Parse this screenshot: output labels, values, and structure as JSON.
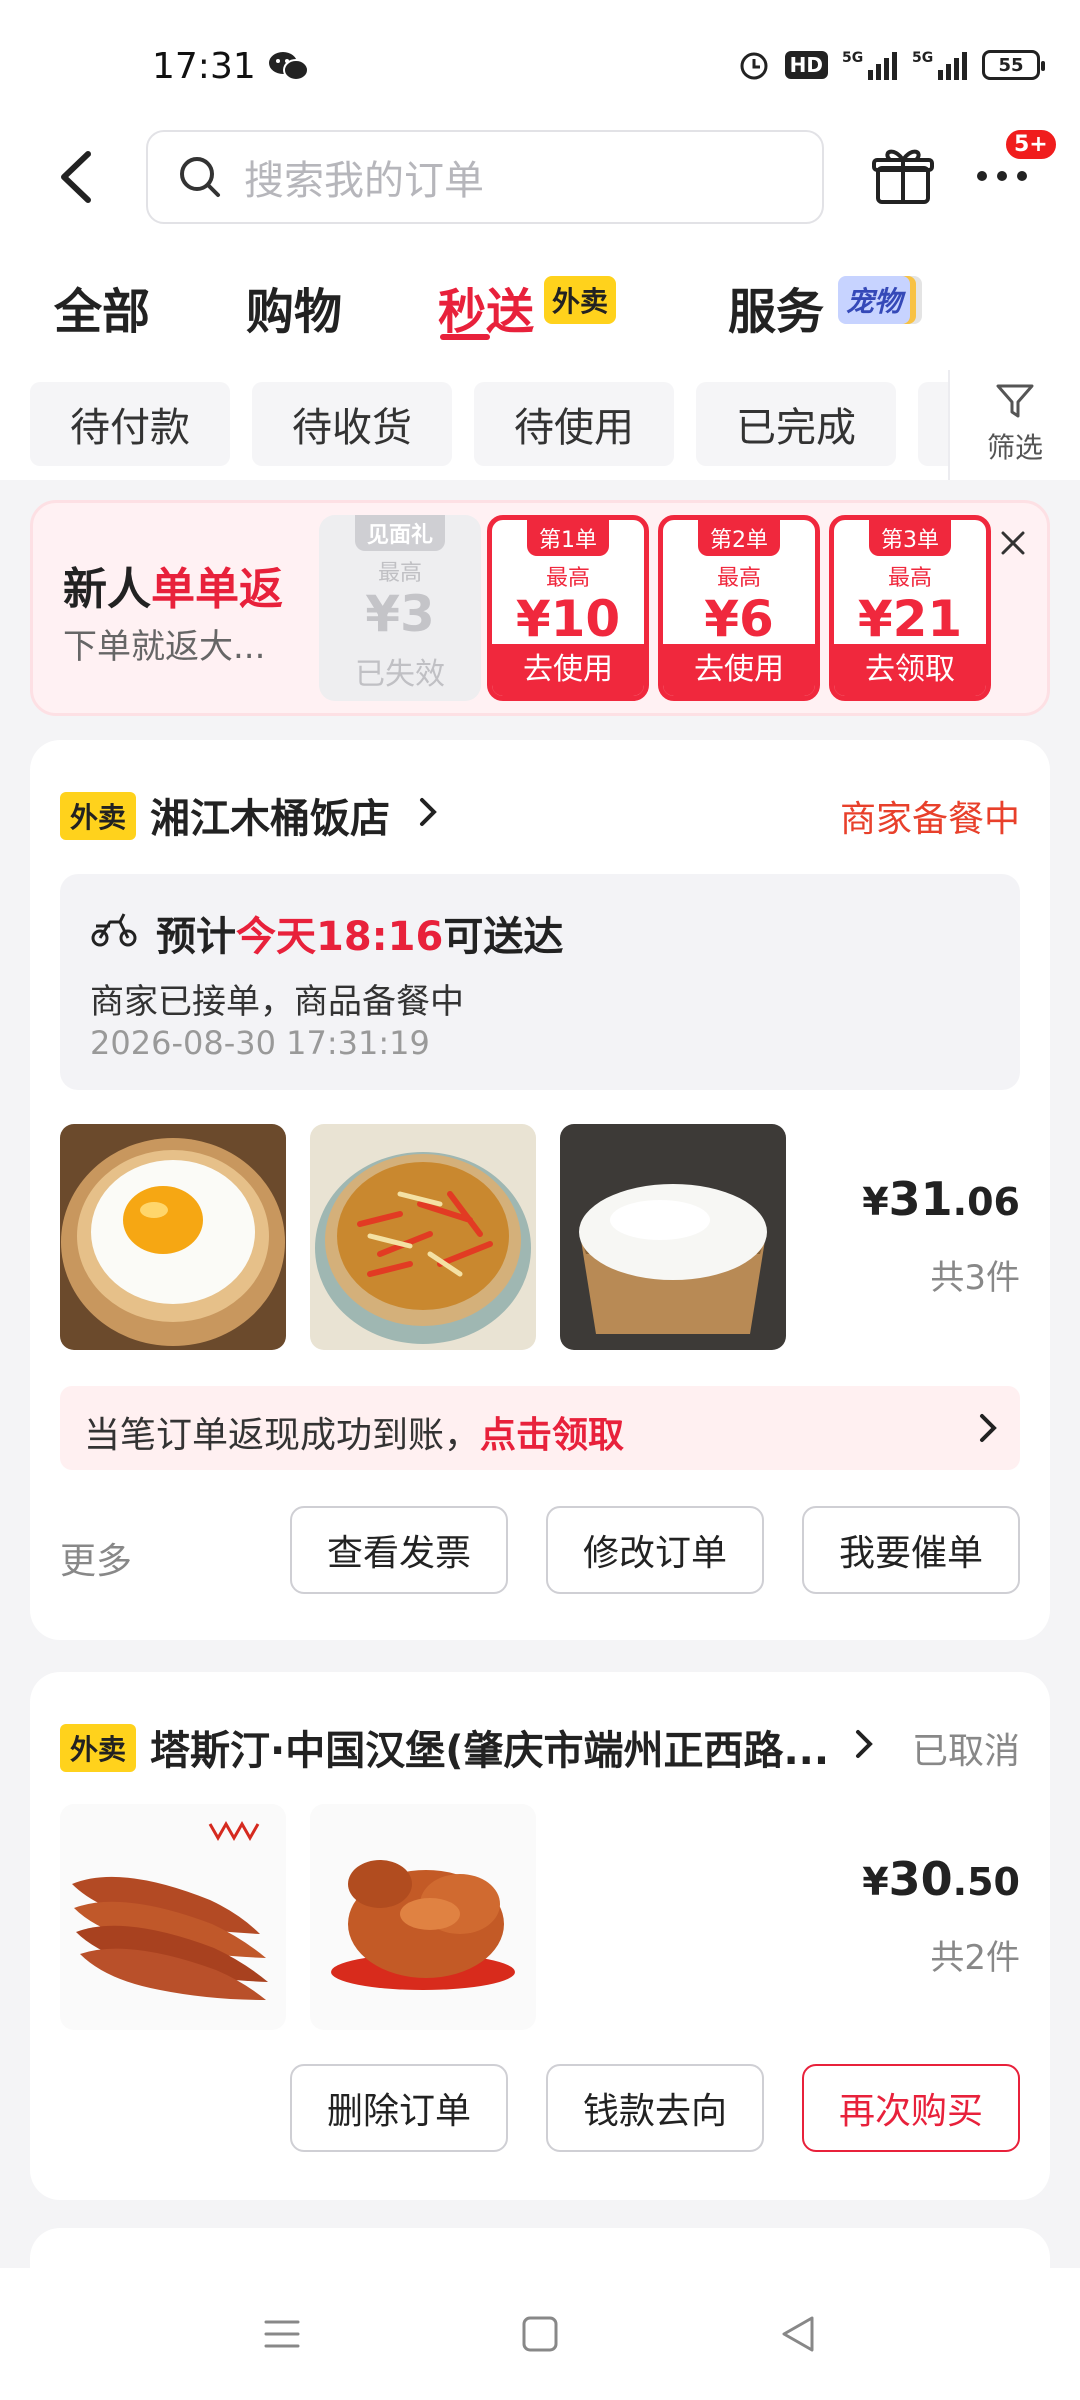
{
  "status_bar": {
    "time": "17:31",
    "battery": "55",
    "icons": [
      "wechat-icon",
      "alarm-icon",
      "hd-icon",
      "5g-signal-icon",
      "5g-signal-icon"
    ]
  },
  "header": {
    "search_placeholder": "搜索我的订单",
    "more_badge": "5+"
  },
  "tabs": [
    {
      "label": "全部",
      "active": false
    },
    {
      "label": "购物",
      "active": false
    },
    {
      "label": "秒送",
      "active": true,
      "tag": "外卖"
    },
    {
      "label": "服务",
      "active": false,
      "tag": "宠物"
    }
  ],
  "filters": {
    "chips": [
      "待付款",
      "待收货",
      "待使用",
      "已完成"
    ],
    "filter_label": "筛选"
  },
  "promo": {
    "title_black": "新人",
    "title_red": "单单返",
    "subtitle": "下单就返大...",
    "coupons": [
      {
        "tag": "见面礼",
        "top": "最高",
        "amount": "¥3",
        "action": "已失效",
        "state": "expired"
      },
      {
        "tag": "第1单",
        "top": "最高",
        "amount": "¥10",
        "action": "去使用",
        "state": "active"
      },
      {
        "tag": "第2单",
        "top": "最高",
        "amount": "¥6",
        "action": "去使用",
        "state": "active"
      },
      {
        "tag": "第3单",
        "top": "最高",
        "amount": "¥21",
        "action": "去领取",
        "state": "active"
      }
    ]
  },
  "orders": [
    {
      "tag": "外卖",
      "shop": "湘江木桶饭店",
      "status": "商家备餐中",
      "status_color": "#e8402b",
      "delivery": {
        "prefix": "预计",
        "highlight": "今天18:16",
        "suffix": "可送达",
        "sub": "商家已接单，商品备餐中",
        "time": "2026-08-30 17:31:19"
      },
      "items": [
        "fried-egg",
        "shredded-pork-rice",
        "white-rice"
      ],
      "price_yen": "¥",
      "price_int": "31",
      "price_dec": ".06",
      "count": "共3件",
      "cashback": {
        "text": "当笔订单返现成功到账，",
        "link": "点击领取"
      },
      "more": "更多",
      "buttons": [
        {
          "label": "查看发票",
          "style": "normal"
        },
        {
          "label": "修改订单",
          "style": "normal"
        },
        {
          "label": "我要催单",
          "style": "normal"
        }
      ]
    },
    {
      "tag": "外卖",
      "shop": "塔斯汀·中国汉堡(肇庆市端州正西路...",
      "status": "已取消",
      "status_color": "#888888",
      "items": [
        "chicken-wings",
        "roast-chicken"
      ],
      "price_yen": "¥",
      "price_int": "30",
      "price_dec": ".50",
      "count": "共2件",
      "buttons": [
        {
          "label": "删除订单",
          "style": "normal"
        },
        {
          "label": "钱款去向",
          "style": "normal"
        },
        {
          "label": "再次购买",
          "style": "red"
        }
      ]
    }
  ],
  "colors": {
    "accent_red": "#e8213b",
    "tag_yellow": "#ffd21c"
  }
}
